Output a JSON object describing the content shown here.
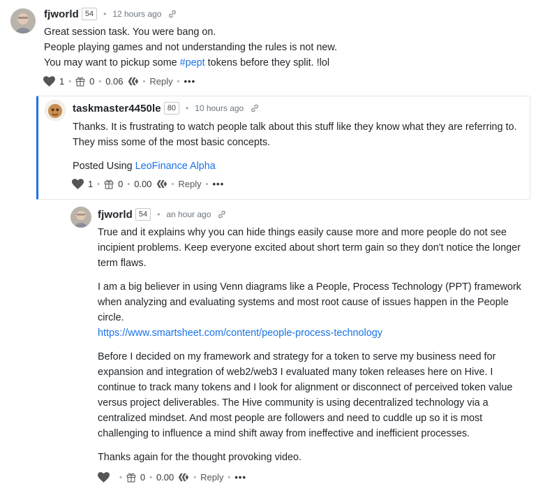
{
  "comments": [
    {
      "author": "fjworld",
      "reputation": "54",
      "time": "12 hours ago",
      "lines": [
        "Great session task. You were bang on.",
        "People playing games and not understanding the rules is not new."
      ],
      "line3_before": "You may want to pickup some ",
      "line3_tag": "#pept",
      "line3_after": " tokens before they split. !lol",
      "votes": "1",
      "gifts": "0",
      "payout": "0.06",
      "reply": "Reply",
      "more": "•••"
    },
    {
      "author": "taskmaster4450le",
      "reputation": "80",
      "time": "10 hours ago",
      "text": "Thanks. It is frustrating to watch people talk about this stuff like they know what they are referring to. They miss some of the most basic concepts.",
      "posted_prefix": "Posted Using ",
      "posted_link": "LeoFinance Alpha",
      "votes": "1",
      "gifts": "0",
      "payout": "0.00",
      "reply": "Reply",
      "more": "•••"
    },
    {
      "author": "fjworld",
      "reputation": "54",
      "time": "an hour ago",
      "p1": "True and it explains why you can hide things easily cause more and more people do not see incipient problems. Keep everyone excited about short term gain so they don't notice the longer term flaws.",
      "p2": "I am a big believer in using Venn diagrams like a People, Process Technology (PPT) framework when analyzing and evaluating systems and most root cause of issues happen in the People circle.",
      "p2_link": "https://www.smartsheet.com/content/people-process-technology",
      "p3": "Before I decided on my framework and strategy for a token to serve my business need for expansion and integration of web2/web3 I evaluated many token releases here on Hive. I continue to track many tokens and I look for alignment or disconnect of perceived token value versus project deliverables. The Hive community is using decentralized technology via a centralized mindset. And most people are followers and need to cuddle up so it is most challenging to influence a mind shift away from ineffective and inefficient processes.",
      "p4": "Thanks again for the thought provoking video.",
      "gifts": "0",
      "payout": "0.00",
      "reply": "Reply",
      "more": "•••"
    }
  ],
  "icons": {
    "vote": "heart-icon",
    "gift": "gift-icon",
    "currency": "hive-icon",
    "permalink": "link-icon",
    "colors": {
      "link": "#1a73e8",
      "thread_bar": "#1a73e8",
      "text": "#212529",
      "muted": "#6c757d"
    }
  }
}
